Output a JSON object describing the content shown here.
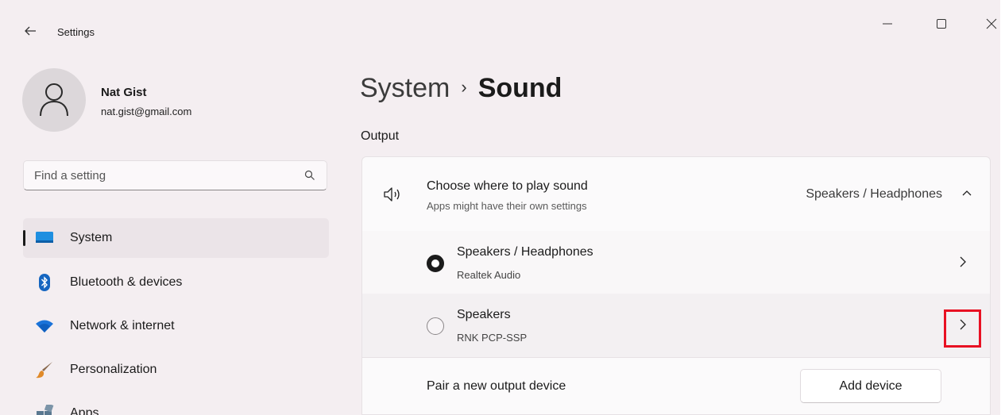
{
  "window": {
    "title": "Settings",
    "controls": [
      "minimize-icon",
      "maximize-icon",
      "close-icon"
    ]
  },
  "user": {
    "name": "Nat Gist",
    "email": "nat.gist@gmail.com"
  },
  "search": {
    "placeholder": "Find a setting"
  },
  "nav": {
    "items": [
      {
        "label": "System",
        "icon": "system-icon",
        "selected": true
      },
      {
        "label": "Bluetooth & devices",
        "icon": "bluetooth-icon"
      },
      {
        "label": "Network & internet",
        "icon": "wifi-icon"
      },
      {
        "label": "Personalization",
        "icon": "brush-icon"
      },
      {
        "label": "Apps",
        "icon": "apps-icon"
      }
    ]
  },
  "breadcrumb": {
    "parent": "System",
    "separator": "›",
    "current": "Sound"
  },
  "output": {
    "section_title": "Output",
    "chooser": {
      "title": "Choose where to play sound",
      "subtitle": "Apps might have their own settings",
      "value": "Speakers / Headphones",
      "expanded": true
    },
    "devices": [
      {
        "name": "Speakers / Headphones",
        "detail": "Realtek Audio",
        "selected": true
      },
      {
        "name": "Speakers",
        "detail": "RNK PCP-SSP",
        "selected": false
      }
    ],
    "pair": {
      "label": "Pair a new output device",
      "button": "Add device"
    }
  },
  "colors": {
    "window_bg": "#f4eef1",
    "card_bg": "#fbfafb",
    "highlight": "#e81123"
  }
}
